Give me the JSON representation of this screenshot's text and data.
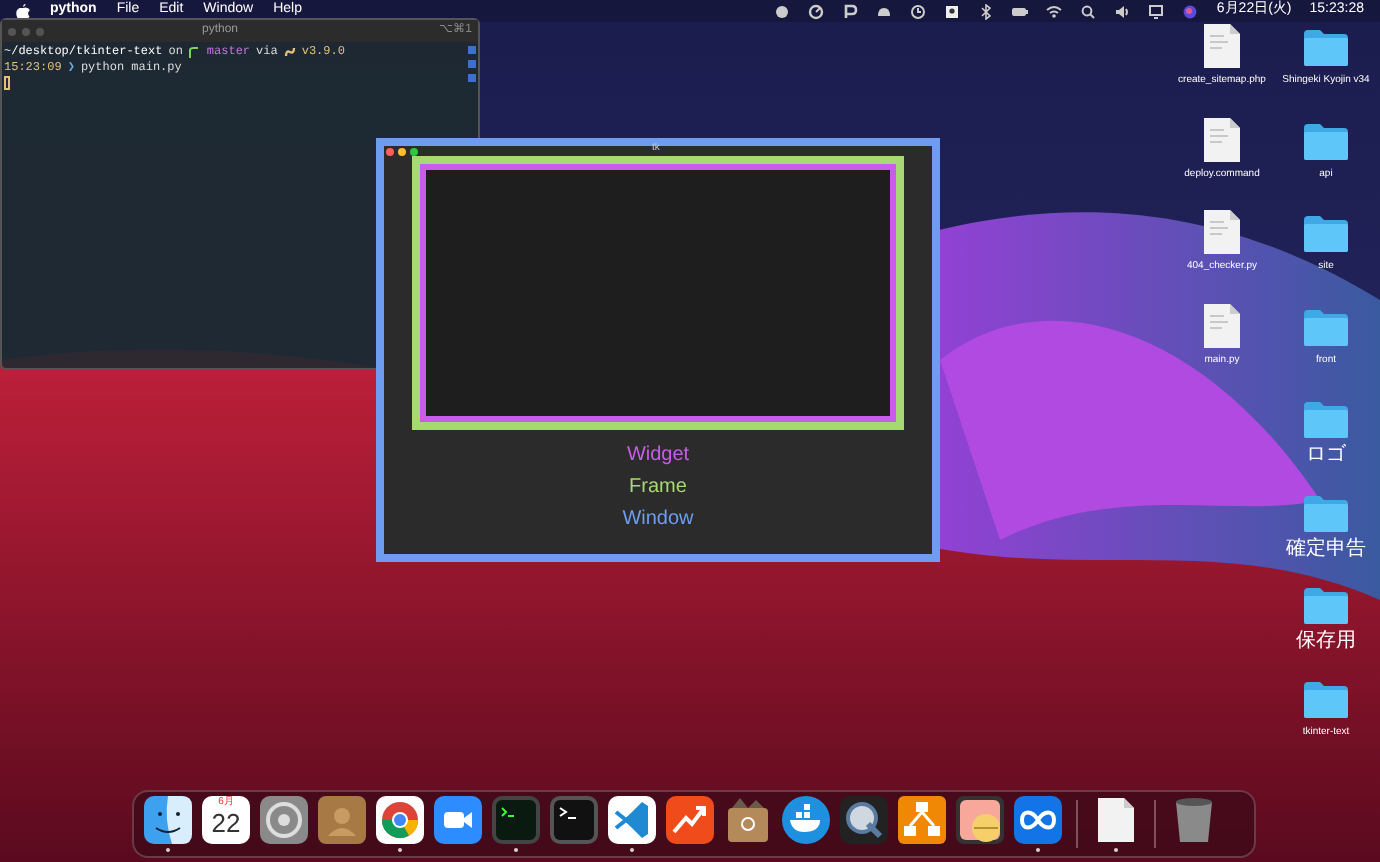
{
  "menu_bar": {
    "app": "python",
    "menus": [
      "File",
      "Edit",
      "Window",
      "Help"
    ],
    "date": "6月22日(火)",
    "time": "15:23:28"
  },
  "terminal": {
    "title": "python",
    "shortcut": "⌥⌘1",
    "lines": [
      {
        "path": "~/desktop/tkinter-text",
        "on": "on",
        "branch": "master",
        "via": "via",
        "version": "v3.9.0"
      },
      {
        "time": "15:23:09",
        "prompt": "❯",
        "command": "python main.py"
      }
    ]
  },
  "tk_window": {
    "title": "tk",
    "layers": [
      {
        "label": "Widget",
        "color": "#c95ce8"
      },
      {
        "label": "Frame",
        "color": "#a6d873"
      },
      {
        "label": "Window",
        "color": "#6d9cf0"
      }
    ]
  },
  "desktop": {
    "columns": [
      [
        {
          "kind": "file",
          "label": "create_sitemap.php"
        },
        {
          "kind": "file",
          "label": "deploy.command"
        },
        {
          "kind": "file",
          "label": "404_checker.py"
        },
        {
          "kind": "file",
          "label": "main.py"
        }
      ],
      [
        {
          "kind": "folder",
          "label": "Shingeki Kyojin v34"
        },
        {
          "kind": "folder",
          "label": "api"
        },
        {
          "kind": "folder",
          "label": "site"
        },
        {
          "kind": "folder",
          "label": "front"
        },
        {
          "kind": "folder",
          "label": "ロゴ"
        },
        {
          "kind": "folder",
          "label": "確定申告"
        },
        {
          "kind": "folder",
          "label": "保存用"
        },
        {
          "kind": "folder",
          "label": "tkinter-text"
        }
      ]
    ]
  },
  "dock": [
    {
      "kind": "finder",
      "running": true
    },
    {
      "kind": "calendar",
      "month": "6月",
      "day": "22",
      "running": false
    },
    {
      "kind": "gear",
      "running": false
    },
    {
      "kind": "contacts",
      "running": false
    },
    {
      "kind": "chrome",
      "running": true
    },
    {
      "kind": "camera",
      "running": false
    },
    {
      "kind": "terminal_green",
      "running": true
    },
    {
      "kind": "terminal",
      "running": false
    },
    {
      "kind": "vscode",
      "running": true
    },
    {
      "kind": "chart",
      "running": false
    },
    {
      "kind": "box",
      "running": false
    },
    {
      "kind": "whale",
      "running": false
    },
    {
      "kind": "quicktime",
      "running": false
    },
    {
      "kind": "flow",
      "running": false
    },
    {
      "kind": "coin",
      "running": false
    },
    {
      "kind": "infinity",
      "running": true
    },
    {
      "kind": "separator"
    },
    {
      "kind": "document",
      "running": true
    },
    {
      "kind": "separator"
    },
    {
      "kind": "trash",
      "running": false
    }
  ]
}
